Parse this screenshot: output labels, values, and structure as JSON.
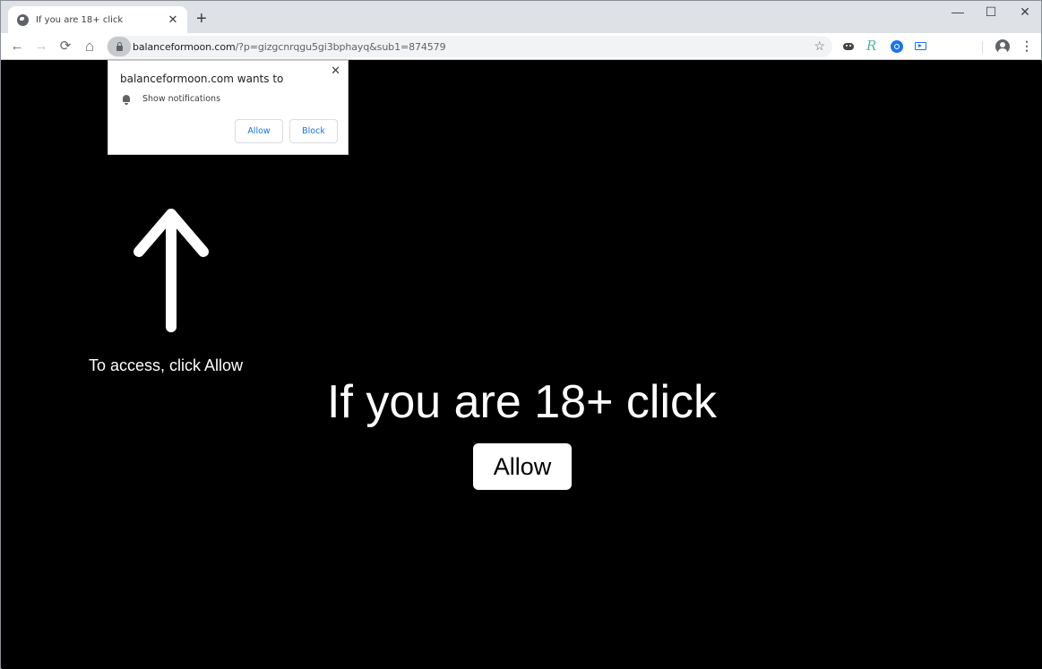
{
  "browser": {
    "tab": {
      "title": "If you are 18+ click",
      "close_symbol": "✕",
      "icon": "globe-icon"
    },
    "new_tab_symbol": "+",
    "window_controls": {
      "minimize": "—",
      "maximize": "☐",
      "close": "✕"
    },
    "nav": {
      "back": "←",
      "forward": "→",
      "reload": "⟳",
      "home": "⌂"
    },
    "address": {
      "domain": "balanceformoon.com",
      "path": "/?p=gizgcnrqgu5gi3bphayq&sub1=874579"
    },
    "bookmark_star": "☆",
    "extensions": [
      "robot-extension-icon",
      "r-extension-icon",
      "search-extension-icon",
      "screen-extension-icon"
    ],
    "ext_r_glyph": "R",
    "menu_glyph": "⋮"
  },
  "permission_popup": {
    "title": "balanceformoon.com wants to",
    "permission": "Show notifications",
    "allow_label": "Allow",
    "block_label": "Block",
    "close_symbol": "✕"
  },
  "page": {
    "hint": "To access, click Allow",
    "headline": "If you are 18+ click",
    "button_label": "Allow",
    "background_color": "#000000",
    "text_color": "#ffffff"
  }
}
